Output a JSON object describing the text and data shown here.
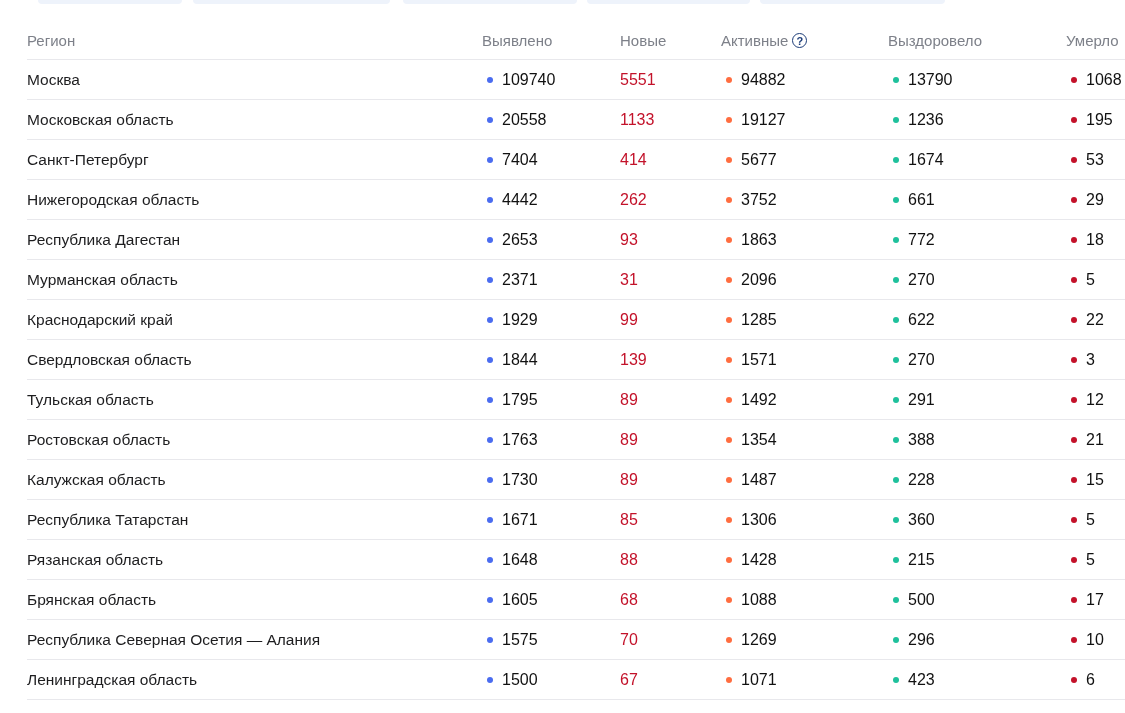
{
  "table": {
    "columns": [
      {
        "label": "Регион",
        "kind": "text"
      },
      {
        "label": "Выявлено",
        "kind": "dot",
        "color": "#4a6cf0"
      },
      {
        "label": "Новые",
        "kind": "red"
      },
      {
        "label": "Активные",
        "kind": "dot",
        "color": "#ff6d3f",
        "help": "?"
      },
      {
        "label": "Выздоровело",
        "kind": "dot",
        "color": "#1ec19c"
      },
      {
        "label": "Умерло",
        "kind": "dot",
        "color": "#c3122a"
      }
    ],
    "rows": [
      [
        "Москва",
        "109740",
        "5551",
        "94882",
        "13790",
        "1068"
      ],
      [
        "Московская область",
        "20558",
        "1133",
        "19127",
        "1236",
        "195"
      ],
      [
        "Санкт-Петербург",
        "7404",
        "414",
        "5677",
        "1674",
        "53"
      ],
      [
        "Нижегородская область",
        "4442",
        "262",
        "3752",
        "661",
        "29"
      ],
      [
        "Республика Дагестан",
        "2653",
        "93",
        "1863",
        "772",
        "18"
      ],
      [
        "Мурманская область",
        "2371",
        "31",
        "2096",
        "270",
        "5"
      ],
      [
        "Краснодарский край",
        "1929",
        "99",
        "1285",
        "622",
        "22"
      ],
      [
        "Свердловская область",
        "1844",
        "139",
        "1571",
        "270",
        "3"
      ],
      [
        "Тульская область",
        "1795",
        "89",
        "1492",
        "291",
        "12"
      ],
      [
        "Ростовская область",
        "1763",
        "89",
        "1354",
        "388",
        "21"
      ],
      [
        "Калужская область",
        "1730",
        "89",
        "1487",
        "228",
        "15"
      ],
      [
        "Республика Татарстан",
        "1671",
        "85",
        "1306",
        "360",
        "5"
      ],
      [
        "Рязанская область",
        "1648",
        "88",
        "1428",
        "215",
        "5"
      ],
      [
        "Брянская область",
        "1605",
        "68",
        "1088",
        "500",
        "17"
      ],
      [
        "Республика Северная Осетия — Алания",
        "1575",
        "70",
        "1269",
        "296",
        "10"
      ],
      [
        "Ленинградская область",
        "1500",
        "67",
        "1071",
        "423",
        "6"
      ]
    ]
  }
}
